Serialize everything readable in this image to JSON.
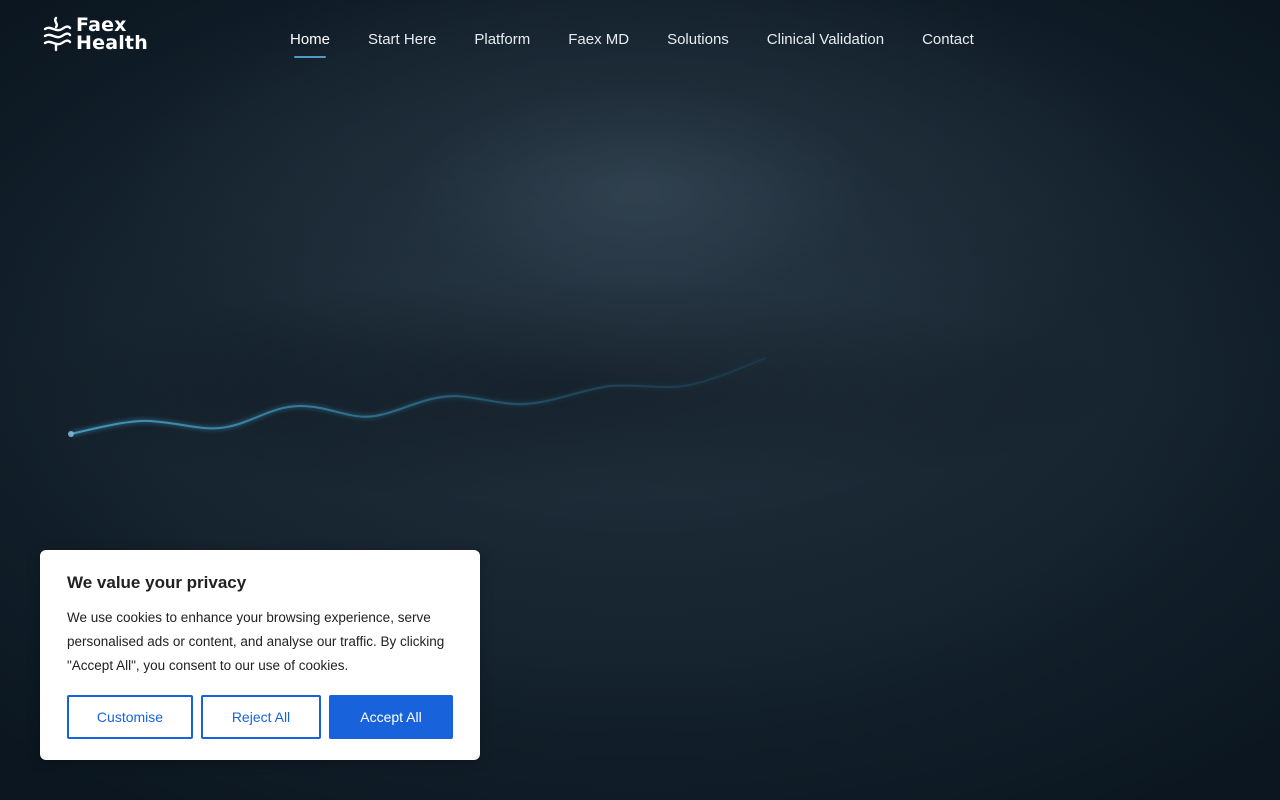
{
  "brand": {
    "line1": "Faex",
    "line2": "Health"
  },
  "nav": {
    "items": [
      {
        "label": "Home",
        "active": true
      },
      {
        "label": "Start Here"
      },
      {
        "label": "Platform"
      },
      {
        "label": "Faex MD"
      },
      {
        "label": "Solutions"
      },
      {
        "label": "Clinical Validation"
      },
      {
        "label": "Contact"
      }
    ]
  },
  "cookie_banner": {
    "title": "We value your privacy",
    "text": "We use cookies to enhance your browsing experience, serve personalised ads or content, and analyse our traffic. By clicking \"Accept All\", you consent to our use of cookies.",
    "customise_label": "Customise",
    "reject_label": "Reject All",
    "accept_label": "Accept All"
  },
  "colors": {
    "background": "#0b1620",
    "accent": "#1863dc",
    "nav_underline": "#4e9bc2",
    "wave": "#3a8fb7"
  }
}
